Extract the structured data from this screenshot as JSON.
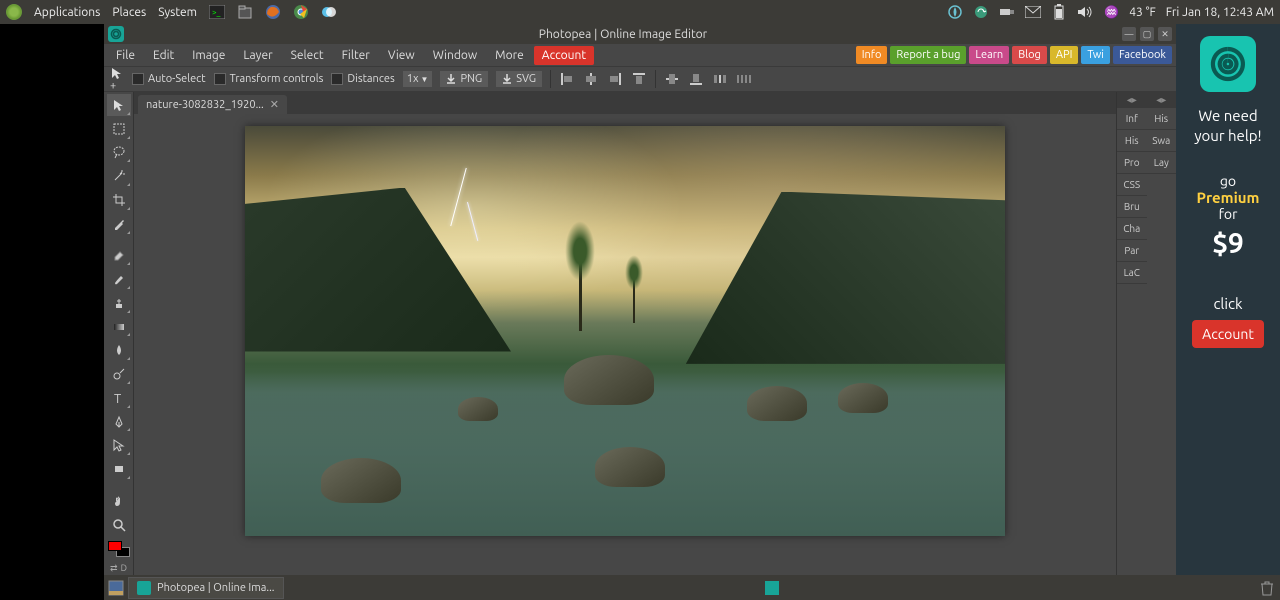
{
  "os_panel": {
    "menus": [
      "Applications",
      "Places",
      "System"
    ],
    "weather": "43 °F",
    "datetime": "Fri Jan 18, 12:43 AM"
  },
  "window": {
    "title": "Photopea | Online Image Editor",
    "controls": {
      "min": "—",
      "max": "▢",
      "close": "✕"
    }
  },
  "menubar": {
    "items": [
      "File",
      "Edit",
      "Image",
      "Layer",
      "Select",
      "Filter",
      "View",
      "Window",
      "More"
    ],
    "account": "Account",
    "tags": [
      {
        "label": "Info",
        "bg": "#f08a24"
      },
      {
        "label": "Report a bug",
        "bg": "#5aa02c"
      },
      {
        "label": "Learn",
        "bg": "#c94a8a"
      },
      {
        "label": "Blog",
        "bg": "#d94a4a"
      },
      {
        "label": "API",
        "bg": "#d9b82b"
      },
      {
        "label": "Twi",
        "bg": "#3aa0e0"
      },
      {
        "label": "Facebook",
        "bg": "#3b5998"
      }
    ]
  },
  "optionsbar": {
    "auto_select": "Auto-Select",
    "transform": "Transform controls",
    "distances": "Distances",
    "zoom": "1x",
    "png": "PNG",
    "svg": "SVG"
  },
  "doc_tab": {
    "label": "nature-3082832_1920...",
    "close": "✕"
  },
  "panel_tabs": {
    "col1": [
      "Inf",
      "His",
      "Pro",
      "CSS",
      "Bru",
      "Cha",
      "Par",
      "LaC"
    ],
    "col2": [
      "His",
      "Swa",
      "Lay"
    ]
  },
  "ad": {
    "help": "We need your help!",
    "go": "go",
    "premium": "Premium",
    "for": "for",
    "price": "$9",
    "click": "click",
    "account": "Account"
  },
  "taskbar": {
    "app": "Photopea | Online Ima..."
  },
  "colors": {
    "fg": "#ff0000",
    "bg": "#000000"
  }
}
